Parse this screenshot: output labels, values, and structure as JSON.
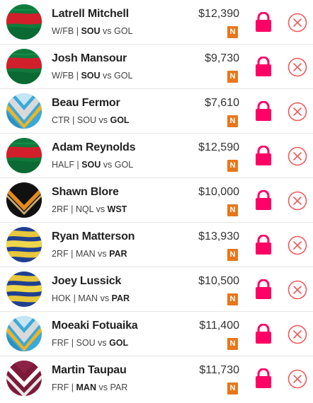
{
  "accent_colors": {
    "lock": "#ff0066",
    "remove": "#f05a5a",
    "badge": "#e8761c"
  },
  "players": [
    {
      "name": "Latrell Mitchell",
      "position": "W/FB",
      "team": "SOU",
      "vs": "vs",
      "opp": "GOL",
      "bold": "team",
      "price": "$12,390",
      "badge": "N",
      "jersey": "rabbitohs"
    },
    {
      "name": "Josh Mansour",
      "position": "W/FB",
      "team": "SOU",
      "vs": "vs",
      "opp": "GOL",
      "bold": "team",
      "price": "$9,730",
      "badge": "N",
      "jersey": "rabbitohs"
    },
    {
      "name": "Beau Fermor",
      "position": "CTR",
      "team": "SOU",
      "vs": "vs",
      "opp": "GOL",
      "bold": "opp",
      "price": "$7,610",
      "badge": "N",
      "jersey": "titans"
    },
    {
      "name": "Adam Reynolds",
      "position": "HALF",
      "team": "SOU",
      "vs": "vs",
      "opp": "GOL",
      "bold": "team",
      "price": "$12,590",
      "badge": "N",
      "jersey": "rabbitohs"
    },
    {
      "name": "Shawn Blore",
      "position": "2RF",
      "team": "NQL",
      "vs": "vs",
      "opp": "WST",
      "bold": "opp",
      "price": "$10,000",
      "badge": "N",
      "jersey": "tigers"
    },
    {
      "name": "Ryan Matterson",
      "position": "2RF",
      "team": "MAN",
      "vs": "vs",
      "opp": "PAR",
      "bold": "opp",
      "price": "$13,930",
      "badge": "N",
      "jersey": "eels"
    },
    {
      "name": "Joey Lussick",
      "position": "HOK",
      "team": "MAN",
      "vs": "vs",
      "opp": "PAR",
      "bold": "opp",
      "price": "$10,500",
      "badge": "N",
      "jersey": "eels"
    },
    {
      "name": "Moeaki Fotuaika",
      "position": "FRF",
      "team": "SOU",
      "vs": "vs",
      "opp": "GOL",
      "bold": "opp",
      "price": "$11,400",
      "badge": "N",
      "jersey": "titans"
    },
    {
      "name": "Martin Taupau",
      "position": "FRF",
      "team": "MAN",
      "vs": "vs",
      "opp": "PAR",
      "bold": "team",
      "price": "$11,730",
      "badge": "N",
      "jersey": "sea-eagles"
    }
  ]
}
